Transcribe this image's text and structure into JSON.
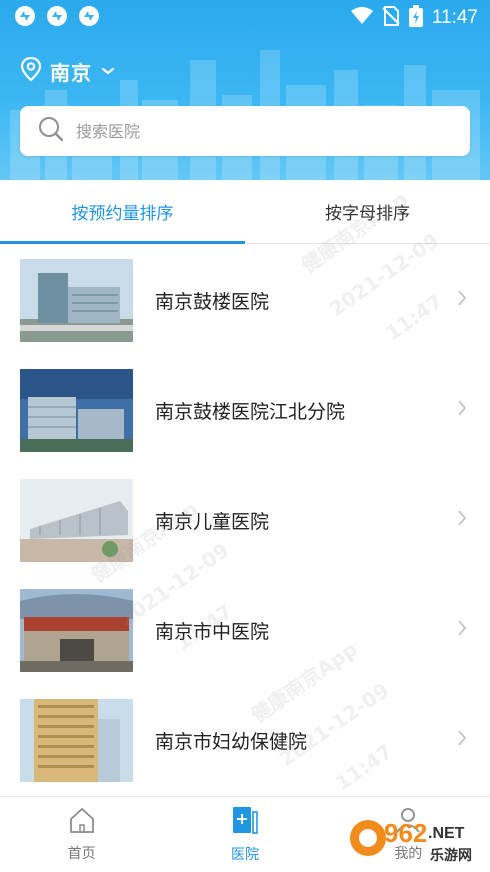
{
  "status_bar": {
    "time": "11:47",
    "left_icons": [
      "sync-app-icon",
      "sync-app-icon",
      "sync-app-icon"
    ],
    "right_icons": [
      "wifi-icon",
      "no-sim-icon",
      "battery-charging-icon"
    ]
  },
  "location": {
    "city": "南京",
    "icon": "location-pin-icon"
  },
  "search": {
    "placeholder": "搜索医院"
  },
  "tabs": [
    {
      "label": "按预约量排序",
      "active": true
    },
    {
      "label": "按字母排序",
      "active": false
    }
  ],
  "hospitals": [
    {
      "name": "南京鼓楼医院"
    },
    {
      "name": "南京鼓楼医院江北分院"
    },
    {
      "name": "南京儿童医院"
    },
    {
      "name": "南京市中医院"
    },
    {
      "name": "南京市妇幼保健院"
    }
  ],
  "bottom_nav": [
    {
      "label": "首页",
      "icon": "home-icon",
      "active": false
    },
    {
      "label": "医院",
      "icon": "hospital-icon",
      "active": true
    },
    {
      "label": "我的",
      "icon": "user-icon",
      "active": false
    }
  ],
  "watermark": {
    "line1": "健康南京App",
    "line2": "2021-12-09",
    "line3": "11:47"
  },
  "site_logo": {
    "text1": "962",
    "text2": ".NET",
    "text3": "乐游网"
  },
  "colors": {
    "header_blue": "#2aa9ee",
    "accent_blue": "#2196e3",
    "text_dark": "#222222"
  }
}
